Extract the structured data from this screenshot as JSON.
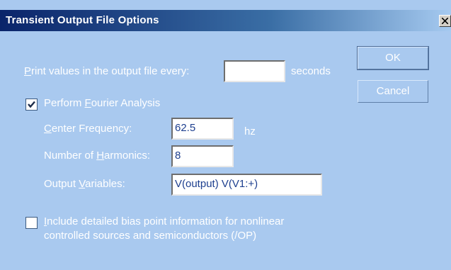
{
  "window": {
    "title": "Transient Output File Options",
    "close_glyph": "X"
  },
  "print": {
    "label_u": "P",
    "label_rest": "rint values in the output file every:",
    "value": "",
    "units": "seconds"
  },
  "fourier": {
    "checked": true,
    "label_pre": "Perform ",
    "label_u": "F",
    "label_rest": "ourier Analysis",
    "center_frequency": {
      "label_u": "C",
      "label_rest": "enter Frequency:",
      "value": "62.5",
      "units": "hz"
    },
    "harmonics": {
      "label_pre": "Number of ",
      "label_u": "H",
      "label_rest": "armonics:",
      "value": "8"
    },
    "output_variables": {
      "label_pre": "Output ",
      "label_u": "V",
      "label_rest": "ariables:",
      "value": "V(output) V(V1:+)"
    }
  },
  "bias": {
    "checked": false,
    "line1_u": "I",
    "line1_rest": "nclude detailed bias point information for nonlinear",
    "line2": "controlled sources and semiconductors (/OP)"
  },
  "buttons": {
    "ok": "OK",
    "cancel": "Cancel"
  },
  "colors": {
    "background": "#a9c9ef",
    "title_bar": "#0a246a",
    "text": "#ffffff"
  }
}
